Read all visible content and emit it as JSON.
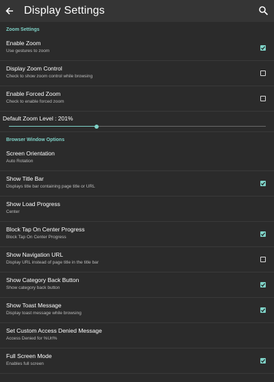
{
  "appbar": {
    "title": "Display Settings",
    "back_icon": "arrow-left-icon",
    "search_icon": "search-icon"
  },
  "zoom_section": {
    "header": "Zoom Settings",
    "items": [
      {
        "title": "Enable Zoom",
        "summary": "Use gestures to zoom",
        "checked": true
      },
      {
        "title": "Display Zoom Control",
        "summary": "Check to show zoom control while browsing",
        "checked": false
      },
      {
        "title": "Enable Forced Zoom",
        "summary": "Check to enable forced zoom",
        "checked": false
      }
    ],
    "zoom_level": {
      "label": "Default Zoom Level : 201%",
      "fraction": 0.34
    }
  },
  "browser_section": {
    "header": "Browser Window Options",
    "items": [
      {
        "title": "Screen Orientation",
        "summary": "Auto Rotation"
      },
      {
        "title": "Show Title Bar",
        "summary": "Displays title bar containing page title or URL",
        "checked": true
      },
      {
        "title": "Show Load Progress",
        "summary": "Center"
      },
      {
        "title": "Block Tap On Center Progress",
        "summary": "Block Tap On Center Progress",
        "checked": true
      },
      {
        "title": "Show Navigation URL",
        "summary": "Display URL instead of page title in the title bar",
        "checked": false
      },
      {
        "title": "Show Category Back Button",
        "summary": "Show category back button",
        "checked": true
      },
      {
        "title": "Show Toast Message",
        "summary": "Display toast message while browsing",
        "checked": true
      },
      {
        "title": "Set Custom Access Denied Message",
        "summary": "Access Denied for %Url%"
      },
      {
        "title": "Full Screen Mode",
        "summary": "Enables full screen",
        "checked": true
      }
    ]
  },
  "colors": {
    "accent": "#7fd3c8",
    "background": "#2b2b2b",
    "appbar": "#353535"
  }
}
